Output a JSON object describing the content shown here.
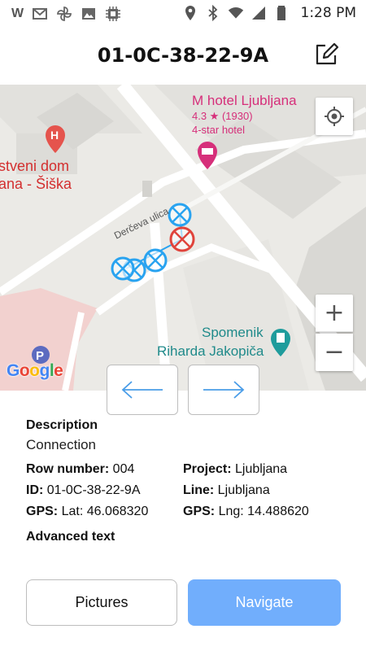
{
  "status_bar": {
    "time": "1:28 PM",
    "left_icons": [
      "w-icon",
      "gmail-icon",
      "pinwheel-icon",
      "image-icon",
      "cpu-icon"
    ],
    "right_icons": [
      "location-pin-icon",
      "bluetooth-icon",
      "wifi-icon",
      "signal-icon",
      "battery-icon"
    ],
    "w_text": "W"
  },
  "header": {
    "title": "01-0C-38-22-9A",
    "edit_icon": "edit-icon"
  },
  "map": {
    "hotel_name": "M hotel Ljubljana",
    "hotel_rating": "4.3 ★ (1930)",
    "hotel_type": "4-star hotel",
    "dom_line1": "stveni dom",
    "dom_line2": "ana - Šiška",
    "street": "Derčeva ulica",
    "monument_line1": "Spomenik",
    "monument_line2": "Riharda Jakopiča",
    "google_letters": [
      "G",
      "o",
      "o",
      "g",
      "l",
      "e"
    ],
    "google_colors": [
      "#4285F4",
      "#EA4335",
      "#FBBC05",
      "#4285F4",
      "#34A853",
      "#EA4335"
    ],
    "zoom_in": "+",
    "zoom_out": "−",
    "marker_blue": "#29a3f0",
    "marker_red": "#e0443c",
    "hotel_color": "#d62f7a",
    "monument_color": "#1f8a8a"
  },
  "nav": {
    "prev_icon": "arrow-left-icon",
    "next_icon": "arrow-right-icon"
  },
  "details": {
    "description_label": "Description",
    "description_value": "Connection",
    "row_number_label": "Row number:",
    "row_number_value": " 004",
    "project_label": "Project:",
    "project_value": " Ljubljana",
    "id_label": "ID:",
    "id_value": " 01-0C-38-22-9A",
    "line_label": "Line:",
    "line_value": " Ljubljana",
    "gps_label_1": "GPS:",
    "gps_value_1": " Lat: 46.068320",
    "gps_label_2": "GPS:",
    "gps_value_2": " Lng: 14.488620",
    "advanced_label": "Advanced text"
  },
  "buttons": {
    "pictures": "Pictures",
    "navigate": "Navigate",
    "navigate_color": "#71aefc"
  }
}
